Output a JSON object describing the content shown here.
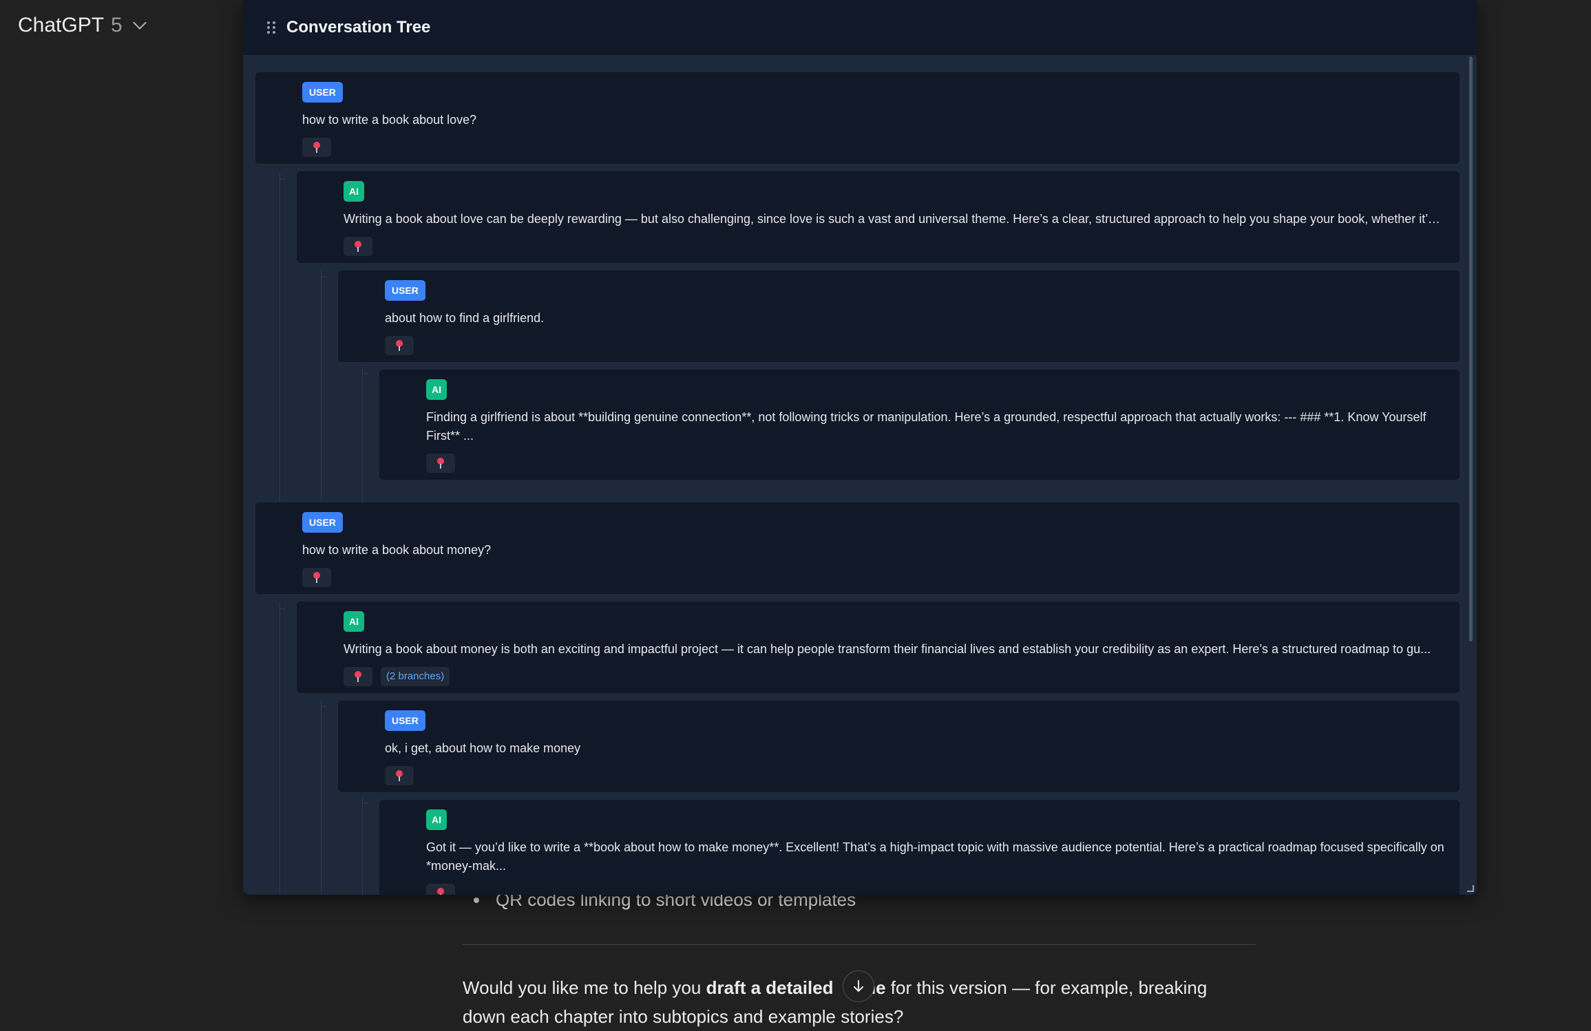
{
  "header": {
    "model_name": "ChatGPT",
    "model_version": "5"
  },
  "panel": {
    "title": "Conversation Tree"
  },
  "nodes": [
    {
      "role": "USER",
      "text": "how to write a book about love?"
    },
    {
      "role": "AI",
      "text": "Writing a book about love can be deeply rewarding — but also challenging, since love is such a vast and universal theme. Here’s a clear, structured approach to help you shape your book, whether it’s f..."
    },
    {
      "role": "USER",
      "text": "about how to find a girlfriend."
    },
    {
      "role": "AI",
      "text": "Finding a girlfriend is about **building genuine connection**, not following tricks or manipulation. Here’s a grounded, respectful approach that actually works:   ---  ### **1. Know Yourself First** ..."
    },
    {
      "role": "USER",
      "text": "how to write a book about money?"
    },
    {
      "role": "AI",
      "text": "Writing a book about money is both an exciting and impactful project — it can help people transform their financial lives and establish your credibility as an expert. Here’s a structured roadmap to gu...",
      "branches": "(2 branches)"
    },
    {
      "role": "USER",
      "text": "ok, i get, about how to make money"
    },
    {
      "role": "AI",
      "text": "Got it — you’d like to write a **book about how to make money**. Excellent! That’s a high-impact topic with massive audience potential.   Here’s a practical roadmap focused specifically on *money-mak..."
    }
  ],
  "chat": {
    "bullet": "QR codes linking to short videos or templates",
    "para_pre": "Would you like me to help you ",
    "para_bold_a": "draft a detailed ",
    "para_bold_b": "line",
    "para_post": " for this version — for example, breaking down each chapter into subtopics and example stories?"
  },
  "colors": {
    "user_badge": "#3b82f6",
    "ai_badge": "#10b981",
    "pin": "#f43f5e",
    "panel_bg": "#1e293b",
    "node_bg": "#111827"
  },
  "icons": {
    "pin": "pushpin-icon",
    "grip": "drag-handle-icon",
    "scroll": "arrow-down-icon"
  }
}
